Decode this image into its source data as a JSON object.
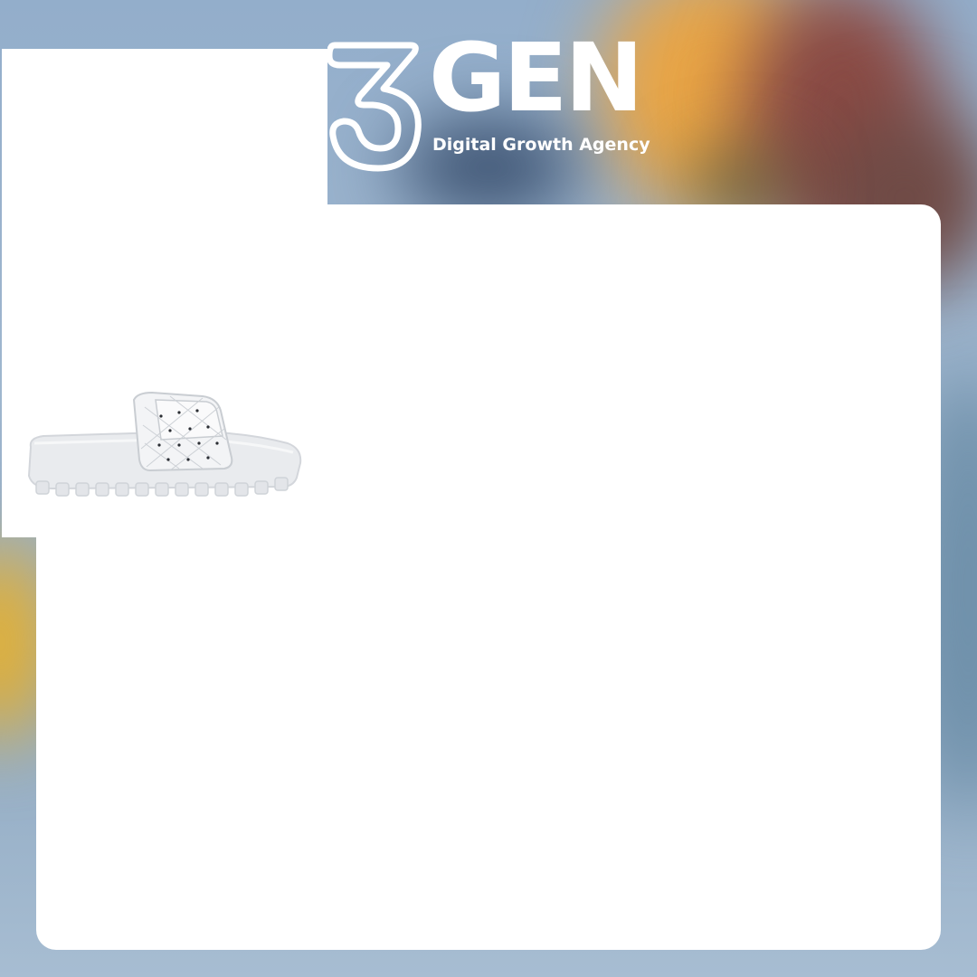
{
  "brand": {
    "mark": "3",
    "name": "GEN",
    "tagline": "Digital Growth Agency",
    "color": "#ffffff"
  },
  "colors": {
    "background_blue": "#93aecb",
    "panel": "#ffffff",
    "sandal": "#eceef1",
    "sandal_pattern": "#2a2d33"
  },
  "product": {
    "icon": "slide-sandal-image"
  }
}
